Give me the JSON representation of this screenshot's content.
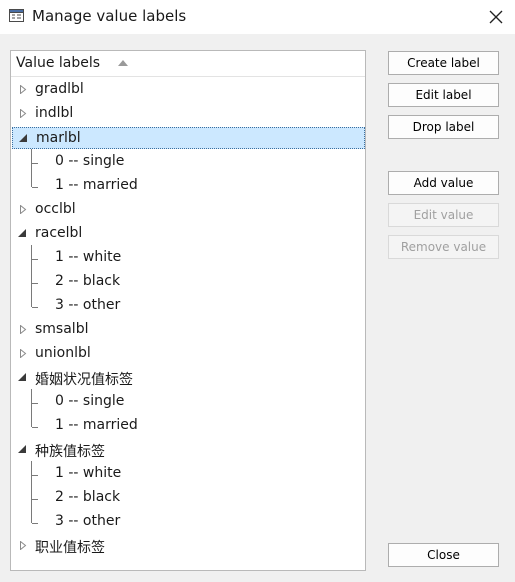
{
  "window": {
    "title": "Manage value labels"
  },
  "tree": {
    "header": "Value labels",
    "nodes": [
      {
        "label": "gradlbl",
        "expanded": false,
        "selected": false,
        "values": []
      },
      {
        "label": "indlbl",
        "expanded": false,
        "selected": false,
        "values": []
      },
      {
        "label": "marlbl",
        "expanded": true,
        "selected": true,
        "values": [
          "0 -- single",
          "1 -- married"
        ]
      },
      {
        "label": "occlbl",
        "expanded": false,
        "selected": false,
        "values": []
      },
      {
        "label": "racelbl",
        "expanded": true,
        "selected": false,
        "values": [
          "1 -- white",
          "2 -- black",
          "3 -- other"
        ]
      },
      {
        "label": "smsalbl",
        "expanded": false,
        "selected": false,
        "values": []
      },
      {
        "label": "unionlbl",
        "expanded": false,
        "selected": false,
        "values": []
      },
      {
        "label": "婚姻状况值标签",
        "expanded": true,
        "selected": false,
        "values": [
          "0 -- single",
          "1 -- married"
        ]
      },
      {
        "label": "种族值标签",
        "expanded": true,
        "selected": false,
        "values": [
          "1 -- white",
          "2 -- black",
          "3 -- other"
        ]
      },
      {
        "label": "职业值标签",
        "expanded": false,
        "selected": false,
        "values": []
      }
    ]
  },
  "buttons": {
    "create_label": "Create label",
    "edit_label": "Edit label",
    "drop_label": "Drop label",
    "add_value": "Add value",
    "edit_value": "Edit value",
    "remove_value": "Remove value",
    "close": "Close"
  }
}
